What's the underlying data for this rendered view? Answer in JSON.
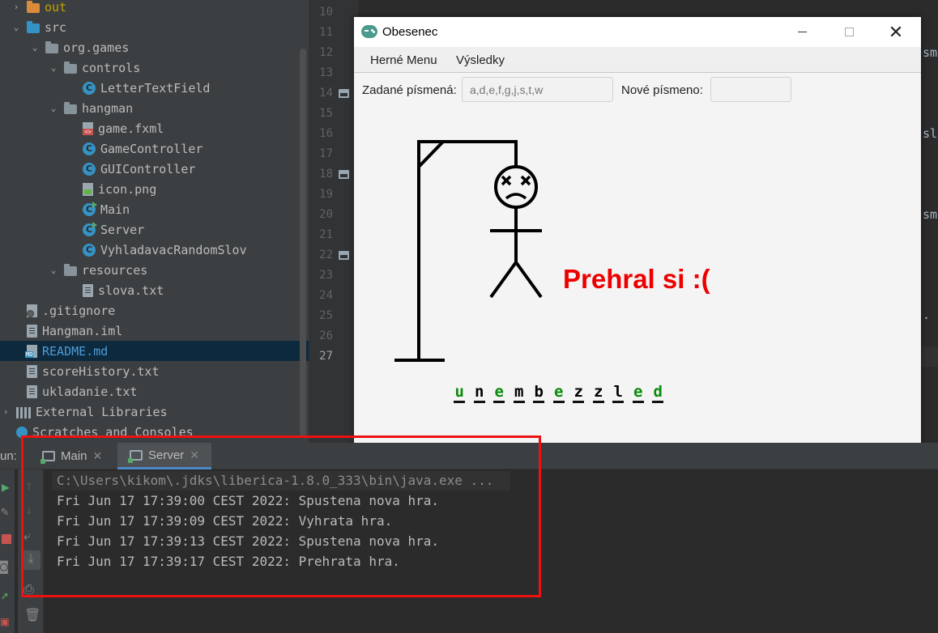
{
  "project_tree": [
    {
      "label": "out",
      "indent": 1,
      "arrow": "›",
      "icon": "folder-orange",
      "color": "#c4a000"
    },
    {
      "label": "src",
      "indent": 1,
      "arrow": "⌄",
      "icon": "folder-blue"
    },
    {
      "label": "org.games",
      "indent": 2,
      "arrow": "⌄",
      "icon": "folder"
    },
    {
      "label": "controls",
      "indent": 3,
      "arrow": "⌄",
      "icon": "folder"
    },
    {
      "label": "LetterTextField",
      "indent": 4,
      "arrow": "",
      "icon": "class"
    },
    {
      "label": "hangman",
      "indent": 3,
      "arrow": "⌄",
      "icon": "folder"
    },
    {
      "label": "game.fxml",
      "indent": 4,
      "arrow": "",
      "icon": "fxml"
    },
    {
      "label": "GameController",
      "indent": 4,
      "arrow": "",
      "icon": "class"
    },
    {
      "label": "GUIController",
      "indent": 4,
      "arrow": "",
      "icon": "class"
    },
    {
      "label": "icon.png",
      "indent": 4,
      "arrow": "",
      "icon": "png"
    },
    {
      "label": "Main",
      "indent": 4,
      "arrow": "",
      "icon": "class-run"
    },
    {
      "label": "Server",
      "indent": 4,
      "arrow": "",
      "icon": "class-run"
    },
    {
      "label": "VyhladavacRandomSlov",
      "indent": 4,
      "arrow": "",
      "icon": "class"
    },
    {
      "label": "resources",
      "indent": 3,
      "arrow": "⌄",
      "icon": "folder"
    },
    {
      "label": "slova.txt",
      "indent": 4,
      "arrow": "",
      "icon": "file"
    },
    {
      "label": ".gitignore",
      "indent": 1,
      "arrow": "",
      "icon": "git"
    },
    {
      "label": "Hangman.iml",
      "indent": 1,
      "arrow": "",
      "icon": "file"
    },
    {
      "label": "README.md",
      "indent": 1,
      "arrow": "",
      "icon": "md",
      "selected": true
    },
    {
      "label": "scoreHistory.txt",
      "indent": 1,
      "arrow": "",
      "icon": "file"
    },
    {
      "label": "ukladanie.txt",
      "indent": 1,
      "arrow": "",
      "icon": "file"
    },
    {
      "label": "External Libraries",
      "indent": 0,
      "arrow": "›",
      "icon": "lib"
    },
    {
      "label": "Scratches and Consoles",
      "indent": 0,
      "arrow": "",
      "icon": "scratch"
    }
  ],
  "editor": {
    "line_numbers": [
      "10",
      "11",
      "12",
      "13",
      "14",
      "15",
      "16",
      "17",
      "18",
      "19",
      "20",
      "21",
      "22",
      "23",
      "24",
      "25",
      "26",
      "27"
    ],
    "current_line": "27",
    "code_fragments": [
      "sm",
      "sl",
      "sm",
      "."
    ]
  },
  "app": {
    "title": "Obesenec",
    "close_symbol": "✕",
    "menu": [
      "Herné Menu",
      "Výsledky"
    ],
    "entered_label": "Zadané písmená:",
    "entered_placeholder": "a,d,e,f,g,j,s,t,w",
    "new_label": "Nové písmeno:",
    "new_value": "",
    "result_message": "Prehral si :(",
    "word_letters": [
      {
        "ch": "u",
        "guessed": true
      },
      {
        "ch": "n",
        "guessed": false
      },
      {
        "ch": "e",
        "guessed": true
      },
      {
        "ch": "m",
        "guessed": false
      },
      {
        "ch": "b",
        "guessed": false
      },
      {
        "ch": "e",
        "guessed": true
      },
      {
        "ch": "z",
        "guessed": false
      },
      {
        "ch": "z",
        "guessed": false
      },
      {
        "ch": "l",
        "guessed": false
      },
      {
        "ch": "e",
        "guessed": true
      },
      {
        "ch": "d",
        "guessed": true
      }
    ],
    "colors": {
      "message": "#ee0000",
      "guessed": "#0a8a0a",
      "missed": "#000000"
    }
  },
  "run_panel": {
    "label": "un:",
    "tabs": [
      {
        "label": "Main",
        "active": false
      },
      {
        "label": "Server",
        "active": true
      }
    ],
    "tab_close_symbol": "✕",
    "command": "C:\\Users\\kikom\\.jdks\\liberica-1.8.0_333\\bin\\java.exe ...",
    "log": [
      "Fri Jun 17 17:39:00 CEST 2022: Spustena nova hra.",
      "Fri Jun 17 17:39:09 CEST 2022: Vyhrata hra.",
      "Fri Jun 17 17:39:13 CEST 2022: Spustena nova hra.",
      "Fri Jun 17 17:39:17 CEST 2022: Prehrata hra."
    ],
    "highlight_color": "#ee1111"
  }
}
